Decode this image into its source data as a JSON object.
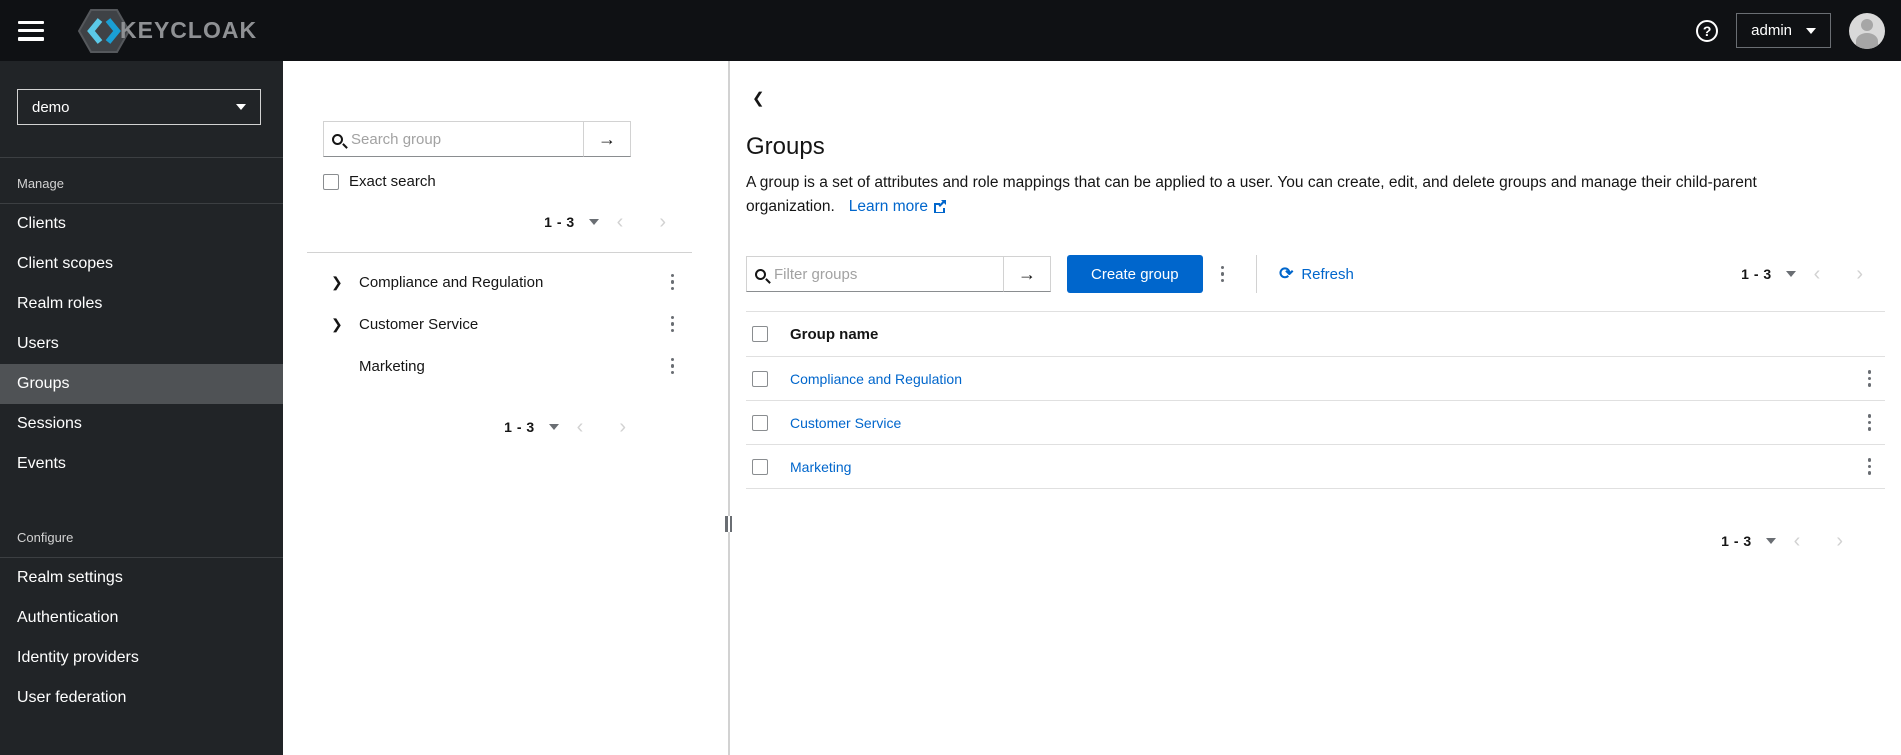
{
  "topbar": {
    "brand": "KEYCLOAK",
    "user_label": "admin"
  },
  "sidebar": {
    "realm": "demo",
    "sections": [
      {
        "label": "Manage",
        "items": [
          {
            "label": "Clients"
          },
          {
            "label": "Client scopes"
          },
          {
            "label": "Realm roles"
          },
          {
            "label": "Users"
          },
          {
            "label": "Groups"
          },
          {
            "label": "Sessions"
          },
          {
            "label": "Events"
          }
        ]
      },
      {
        "label": "Configure",
        "items": [
          {
            "label": "Realm settings"
          },
          {
            "label": "Authentication"
          },
          {
            "label": "Identity providers"
          },
          {
            "label": "User federation"
          }
        ]
      }
    ],
    "active_item": "Groups"
  },
  "tree_panel": {
    "search": {
      "placeholder": "Search group"
    },
    "exact_search_label": "Exact search",
    "pagination_top": "1 - 3",
    "pagination_bottom": "1 - 3",
    "items": [
      {
        "label": "Compliance and Regulation",
        "expandable": true
      },
      {
        "label": "Customer Service",
        "expandable": true
      },
      {
        "label": "Marketing",
        "expandable": false
      }
    ]
  },
  "main": {
    "title": "Groups",
    "description": "A group is a set of attributes and role mappings that can be applied to a user. You can create, edit, and delete groups and manage their child-parent organization.",
    "learn_more_label": "Learn more",
    "filter": {
      "placeholder": "Filter groups"
    },
    "create_button_label": "Create group",
    "refresh_label": "Refresh",
    "pagination_top": "1 - 3",
    "pagination_bottom": "1 - 3",
    "table": {
      "header": "Group name",
      "rows": [
        {
          "name": "Compliance and Regulation"
        },
        {
          "name": "Customer Service"
        },
        {
          "name": "Marketing"
        }
      ]
    }
  },
  "colors": {
    "primary": "#0066cc",
    "link": "#0066cc",
    "topbar_bg": "#0f1114",
    "sidebar_bg": "#212427",
    "sidebar_active": "#4f5255",
    "border": "#d2d2d2",
    "text": "#151515",
    "brand_grey": "#8f9194",
    "brand_cyan_light": "#5bc9e8",
    "brand_cyan_dark": "#1a9fd4"
  }
}
